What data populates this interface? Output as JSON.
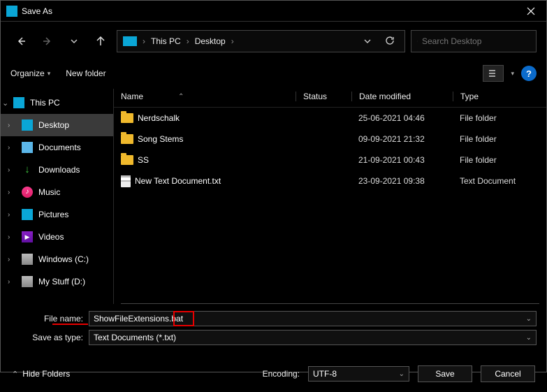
{
  "title": "Save As",
  "breadcrumb": {
    "root": "This PC",
    "current": "Desktop"
  },
  "search": {
    "placeholder": "Search Desktop"
  },
  "toolbar": {
    "organize": "Organize",
    "newFolder": "New folder"
  },
  "sidebar": {
    "root": "This PC",
    "items": [
      {
        "label": "Desktop"
      },
      {
        "label": "Documents"
      },
      {
        "label": "Downloads"
      },
      {
        "label": "Music"
      },
      {
        "label": "Pictures"
      },
      {
        "label": "Videos"
      },
      {
        "label": "Windows (C:)"
      },
      {
        "label": "My Stuff (D:)"
      }
    ]
  },
  "columns": {
    "name": "Name",
    "status": "Status",
    "date": "Date modified",
    "type": "Type"
  },
  "rows": [
    {
      "name": "Nerdschalk",
      "date": "25-06-2021 04:46",
      "type": "File folder",
      "icon": "folder"
    },
    {
      "name": "Song Stems",
      "date": "09-09-2021 21:32",
      "type": "File folder",
      "icon": "folder"
    },
    {
      "name": "SS",
      "date": "21-09-2021 00:43",
      "type": "File folder",
      "icon": "folder"
    },
    {
      "name": "New Text Document.txt",
      "date": "23-09-2021 09:38",
      "type": "Text Document",
      "icon": "txt"
    }
  ],
  "form": {
    "fileNameLabel": "File name:",
    "fileName": "ShowFileExtensions.bat",
    "saveTypeLabel": "Save as type:",
    "saveType": "Text Documents (*.txt)"
  },
  "encoding": {
    "label": "Encoding:",
    "value": "UTF-8"
  },
  "buttons": {
    "save": "Save",
    "cancel": "Cancel"
  },
  "hideFolders": "Hide Folders"
}
